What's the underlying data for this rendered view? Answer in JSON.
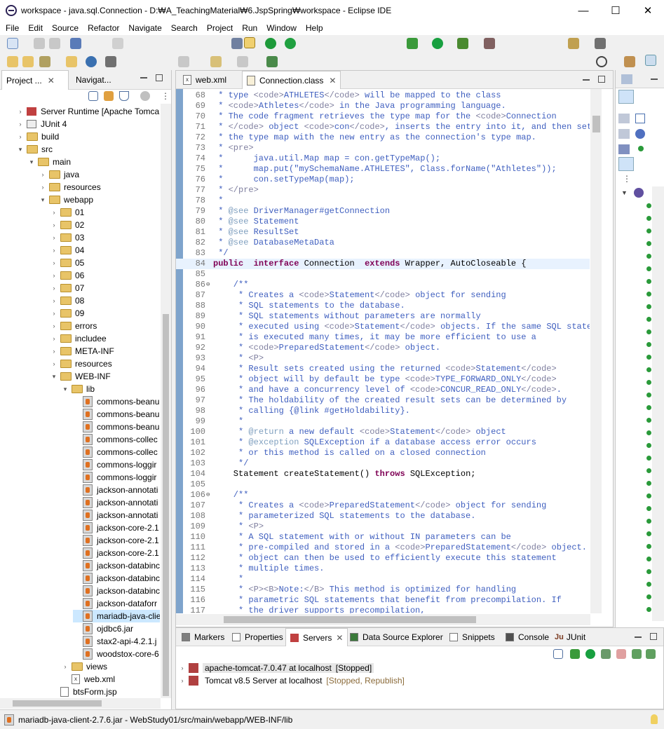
{
  "window": {
    "title": "workspace - java.sql.Connection - D:₩A_TeachingMaterial₩6.JspSpring₩workspace - Eclipse IDE",
    "minimize": "—",
    "maximize": "☐",
    "close": "✕"
  },
  "menu": [
    "File",
    "Edit",
    "Source",
    "Refactor",
    "Navigate",
    "Search",
    "Project",
    "Run",
    "Window",
    "Help"
  ],
  "left": {
    "tabs": [
      "Project ...",
      "Navigat..."
    ],
    "tree": [
      {
        "label": "Server Runtime [Apache Tomca",
        "icon": "server-runtime-icon",
        "depth": 1
      },
      {
        "label": "JUnit 4",
        "icon": "junit-library-icon",
        "depth": 1
      },
      {
        "label": "build",
        "icon": "folder-icon",
        "depth": 1
      },
      {
        "label": "src",
        "icon": "folder-icon",
        "depth": 1
      },
      {
        "label": "main",
        "icon": "folder-icon",
        "depth": 2
      },
      {
        "label": "java",
        "icon": "folder-icon",
        "depth": 3
      },
      {
        "label": "resources",
        "icon": "folder-icon",
        "depth": 3
      },
      {
        "label": "webapp",
        "icon": "folder-icon",
        "depth": 3
      },
      {
        "label": "01",
        "icon": "folder-icon",
        "depth": 4
      },
      {
        "label": "02",
        "icon": "folder-icon",
        "depth": 4
      },
      {
        "label": "03",
        "icon": "folder-icon",
        "depth": 4
      },
      {
        "label": "04",
        "icon": "folder-icon",
        "depth": 4
      },
      {
        "label": "05",
        "icon": "folder-icon",
        "depth": 4
      },
      {
        "label": "06",
        "icon": "folder-icon",
        "depth": 4
      },
      {
        "label": "07",
        "icon": "folder-icon",
        "depth": 4
      },
      {
        "label": "08",
        "icon": "folder-icon",
        "depth": 4
      },
      {
        "label": "09",
        "icon": "folder-icon",
        "depth": 4
      },
      {
        "label": "errors",
        "icon": "folder-icon",
        "depth": 4
      },
      {
        "label": "includee",
        "icon": "folder-icon",
        "depth": 4
      },
      {
        "label": "META-INF",
        "icon": "folder-icon",
        "depth": 4
      },
      {
        "label": "resources",
        "icon": "folder-icon",
        "depth": 4
      },
      {
        "label": "WEB-INF",
        "icon": "folder-icon",
        "depth": 4
      },
      {
        "label": "lib",
        "icon": "folder-icon",
        "depth": 5
      },
      {
        "label": "commons-beanu",
        "icon": "jar-icon",
        "depth": 6
      },
      {
        "label": "commons-beanu",
        "icon": "jar-icon",
        "depth": 6
      },
      {
        "label": "commons-beanu",
        "icon": "jar-icon",
        "depth": 6
      },
      {
        "label": "commons-collec",
        "icon": "jar-icon",
        "depth": 6
      },
      {
        "label": "commons-collec",
        "icon": "jar-icon",
        "depth": 6
      },
      {
        "label": "commons-loggir",
        "icon": "jar-icon",
        "depth": 6
      },
      {
        "label": "commons-loggir",
        "icon": "jar-icon",
        "depth": 6
      },
      {
        "label": "jackson-annotati",
        "icon": "jar-icon",
        "depth": 6
      },
      {
        "label": "jackson-annotati",
        "icon": "jar-icon",
        "depth": 6
      },
      {
        "label": "jackson-annotati",
        "icon": "jar-icon",
        "depth": 6
      },
      {
        "label": "jackson-core-2.1",
        "icon": "jar-icon",
        "depth": 6
      },
      {
        "label": "jackson-core-2.1",
        "icon": "jar-icon",
        "depth": 6
      },
      {
        "label": "jackson-core-2.1",
        "icon": "jar-icon",
        "depth": 6
      },
      {
        "label": "jackson-databinc",
        "icon": "jar-icon",
        "depth": 6
      },
      {
        "label": "jackson-databinc",
        "icon": "jar-icon",
        "depth": 6
      },
      {
        "label": "jackson-databinc",
        "icon": "jar-icon",
        "depth": 6
      },
      {
        "label": "jackson-dataforr",
        "icon": "jar-icon",
        "depth": 6
      },
      {
        "label": "mariadb-java-clie",
        "icon": "jar-icon",
        "depth": 6
      },
      {
        "label": "ojdbc6.jar",
        "icon": "jar-icon",
        "depth": 6
      },
      {
        "label": "stax2-api-4.2.1.j",
        "icon": "jar-icon",
        "depth": 6
      },
      {
        "label": "woodstox-core-6",
        "icon": "jar-icon",
        "depth": 6
      },
      {
        "label": "views",
        "icon": "folder-icon",
        "depth": 5
      },
      {
        "label": "web.xml",
        "icon": "xml-file-icon",
        "depth": 5
      },
      {
        "label": "btsForm.jsp",
        "icon": "jsp-file-icon",
        "depth": 4
      }
    ]
  },
  "editor": {
    "tabs": [
      "web.xml",
      "Connection.class"
    ],
    "lines": [
      {
        "n": "68",
        "t": [
          [
            "cm",
            " * type "
          ],
          [
            "tag",
            "<code>"
          ],
          [
            "cm",
            "ATHLETES"
          ],
          [
            "tag",
            "</code>"
          ],
          [
            "cm",
            " will be mapped to the class"
          ]
        ]
      },
      {
        "n": "69",
        "t": [
          [
            "cm",
            " * "
          ],
          [
            "tag",
            "<code>"
          ],
          [
            "cm",
            "Athletes"
          ],
          [
            "tag",
            "</code>"
          ],
          [
            "cm",
            " in the Java programming language."
          ]
        ]
      },
      {
        "n": "70",
        "t": [
          [
            "cm",
            " * The code fragment retrieves the type map for the "
          ],
          [
            "tag",
            "<code>"
          ],
          [
            "cm",
            "Connection"
          ]
        ]
      },
      {
        "n": "71",
        "t": [
          [
            "cm",
            " * "
          ],
          [
            "tag",
            "</code>"
          ],
          [
            "cm",
            " object "
          ],
          [
            "tag",
            "<code>"
          ],
          [
            "cm",
            "con"
          ],
          [
            "tag",
            "</code>"
          ],
          [
            "cm",
            ", inserts the entry into it, and then sets"
          ]
        ]
      },
      {
        "n": "72",
        "t": [
          [
            "cm",
            " * the type map with the new entry as the connection's type map."
          ]
        ]
      },
      {
        "n": "73",
        "t": [
          [
            "cm",
            " * "
          ],
          [
            "tag",
            "<pre>"
          ]
        ]
      },
      {
        "n": "74",
        "t": [
          [
            "cm",
            " *      java.util.Map map = con.getTypeMap();"
          ]
        ]
      },
      {
        "n": "75",
        "t": [
          [
            "cm",
            " *      map.put(\"mySchemaName.ATHLETES\", Class.forName(\"Athletes\"));"
          ]
        ]
      },
      {
        "n": "76",
        "t": [
          [
            "cm",
            " *      con.setTypeMap(map);"
          ]
        ]
      },
      {
        "n": "77",
        "t": [
          [
            "cm",
            " * "
          ],
          [
            "tag",
            "</pre>"
          ]
        ]
      },
      {
        "n": "78",
        "t": [
          [
            "cm",
            " *"
          ]
        ]
      },
      {
        "n": "79",
        "t": [
          [
            "cm",
            " * "
          ],
          [
            "ann",
            "@see"
          ],
          [
            "cm",
            " DriverManager#getConnection"
          ]
        ]
      },
      {
        "n": "80",
        "t": [
          [
            "cm",
            " * "
          ],
          [
            "ann",
            "@see"
          ],
          [
            "cm",
            " Statement"
          ]
        ]
      },
      {
        "n": "81",
        "t": [
          [
            "cm",
            " * "
          ],
          [
            "ann",
            "@see"
          ],
          [
            "cm",
            " ResultSet"
          ]
        ]
      },
      {
        "n": "82",
        "t": [
          [
            "cm",
            " * "
          ],
          [
            "ann",
            "@see"
          ],
          [
            "cm",
            " DatabaseMetaData"
          ]
        ]
      },
      {
        "n": "83",
        "t": [
          [
            "cm",
            " */"
          ]
        ]
      },
      {
        "n": "84",
        "t": [
          [
            "kw",
            "public"
          ],
          [
            "",
            "  "
          ],
          [
            "kw",
            "interface"
          ],
          [
            "",
            " Connection  "
          ],
          [
            "kw",
            "extends"
          ],
          [
            "",
            " Wrapper, AutoCloseable {"
          ]
        ]
      },
      {
        "n": "85",
        "t": []
      },
      {
        "n": "86",
        "t": [
          [
            "cm",
            "    /**"
          ]
        ]
      },
      {
        "n": "87",
        "t": [
          [
            "cm",
            "     * Creates a "
          ],
          [
            "tag",
            "<code>"
          ],
          [
            "cm",
            "Statement"
          ],
          [
            "tag",
            "</code>"
          ],
          [
            "cm",
            " object for sending"
          ]
        ]
      },
      {
        "n": "88",
        "t": [
          [
            "cm",
            "     * SQL statements to the database."
          ]
        ]
      },
      {
        "n": "89",
        "t": [
          [
            "cm",
            "     * SQL statements without parameters are normally"
          ]
        ]
      },
      {
        "n": "90",
        "t": [
          [
            "cm",
            "     * executed using "
          ],
          [
            "tag",
            "<code>"
          ],
          [
            "cm",
            "Statement"
          ],
          [
            "tag",
            "</code>"
          ],
          [
            "cm",
            " objects. If the same SQL stateme"
          ]
        ]
      },
      {
        "n": "91",
        "t": [
          [
            "cm",
            "     * is executed many times, it may be more efficient to use a"
          ]
        ]
      },
      {
        "n": "92",
        "t": [
          [
            "cm",
            "     * "
          ],
          [
            "tag",
            "<code>"
          ],
          [
            "cm",
            "PreparedStatement"
          ],
          [
            "tag",
            "</code>"
          ],
          [
            "cm",
            " object."
          ]
        ]
      },
      {
        "n": "93",
        "t": [
          [
            "cm",
            "     * "
          ],
          [
            "tag",
            "<P>"
          ]
        ]
      },
      {
        "n": "94",
        "t": [
          [
            "cm",
            "     * Result sets created using the returned "
          ],
          [
            "tag",
            "<code>"
          ],
          [
            "cm",
            "Statement"
          ],
          [
            "tag",
            "</code>"
          ]
        ]
      },
      {
        "n": "95",
        "t": [
          [
            "cm",
            "     * object will by default be type "
          ],
          [
            "tag",
            "<code>"
          ],
          [
            "cm",
            "TYPE_FORWARD_ONLY"
          ],
          [
            "tag",
            "</code>"
          ]
        ]
      },
      {
        "n": "96",
        "t": [
          [
            "cm",
            "     * and have a concurrency level of "
          ],
          [
            "tag",
            "<code>"
          ],
          [
            "cm",
            "CONCUR_READ_ONLY"
          ],
          [
            "tag",
            "</code>"
          ],
          [
            "cm",
            "."
          ]
        ]
      },
      {
        "n": "97",
        "t": [
          [
            "cm",
            "     * The holdability of the created result sets can be determined by"
          ]
        ]
      },
      {
        "n": "98",
        "t": [
          [
            "cm",
            "     * calling {@link #getHoldability}."
          ]
        ]
      },
      {
        "n": "99",
        "t": [
          [
            "cm",
            "     *"
          ]
        ]
      },
      {
        "n": "100",
        "t": [
          [
            "cm",
            "     * "
          ],
          [
            "ann",
            "@return"
          ],
          [
            "cm",
            " a new default "
          ],
          [
            "tag",
            "<code>"
          ],
          [
            "cm",
            "Statement"
          ],
          [
            "tag",
            "</code>"
          ],
          [
            "cm",
            " object"
          ]
        ]
      },
      {
        "n": "101",
        "t": [
          [
            "cm",
            "     * "
          ],
          [
            "ann",
            "@exception"
          ],
          [
            "cm",
            " SQLException if a database access error occurs"
          ]
        ]
      },
      {
        "n": "102",
        "t": [
          [
            "cm",
            "     * or this method is called on a closed connection"
          ]
        ]
      },
      {
        "n": "103",
        "t": [
          [
            "cm",
            "     */"
          ]
        ]
      },
      {
        "n": "104",
        "t": [
          [
            "",
            "    Statement createStatement() "
          ],
          [
            "kw",
            "throws"
          ],
          [
            "",
            " SQLException;"
          ]
        ]
      },
      {
        "n": "105",
        "t": []
      },
      {
        "n": "106",
        "t": [
          [
            "cm",
            "    /**"
          ]
        ]
      },
      {
        "n": "107",
        "t": [
          [
            "cm",
            "     * Creates a "
          ],
          [
            "tag",
            "<code>"
          ],
          [
            "cm",
            "PreparedStatement"
          ],
          [
            "tag",
            "</code>"
          ],
          [
            "cm",
            " object for sending"
          ]
        ]
      },
      {
        "n": "108",
        "t": [
          [
            "cm",
            "     * parameterized SQL statements to the database."
          ]
        ]
      },
      {
        "n": "109",
        "t": [
          [
            "cm",
            "     * "
          ],
          [
            "tag",
            "<P>"
          ]
        ]
      },
      {
        "n": "110",
        "t": [
          [
            "cm",
            "     * A SQL statement with or without IN parameters can be"
          ]
        ]
      },
      {
        "n": "111",
        "t": [
          [
            "cm",
            "     * pre-compiled and stored in a "
          ],
          [
            "tag",
            "<code>"
          ],
          [
            "cm",
            "PreparedStatement"
          ],
          [
            "tag",
            "</code>"
          ],
          [
            "cm",
            " object. Th"
          ]
        ]
      },
      {
        "n": "112",
        "t": [
          [
            "cm",
            "     * object can then be used to efficiently execute this statement"
          ]
        ]
      },
      {
        "n": "113",
        "t": [
          [
            "cm",
            "     * multiple times."
          ]
        ]
      },
      {
        "n": "114",
        "t": [
          [
            "cm",
            "     *"
          ]
        ]
      },
      {
        "n": "115",
        "t": [
          [
            "cm",
            "     * "
          ],
          [
            "tag",
            "<P><B>"
          ],
          [
            "cm",
            "Note:"
          ],
          [
            "tag",
            "</B>"
          ],
          [
            "cm",
            " This method is optimized for handling"
          ]
        ]
      },
      {
        "n": "116",
        "t": [
          [
            "cm",
            "     * parametric SQL statements that benefit from precompilation. If"
          ]
        ]
      },
      {
        "n": "117",
        "t": [
          [
            "cm",
            "     * the driver supports precompilation,"
          ]
        ]
      }
    ]
  },
  "bottom": {
    "tabs": [
      "Markers",
      "Properties",
      "Servers",
      "Data Source Explorer",
      "Snippets",
      "Console",
      "JUnit"
    ],
    "servers": [
      {
        "name": "apache-tomcat-7.0.47 at localhost",
        "state": "[Stopped]"
      },
      {
        "name": "Tomcat v8.5 Server at localhost",
        "state": "[Stopped, Republish]"
      }
    ]
  },
  "status": {
    "text": "mariadb-java-client-2.7.6.jar - WebStudy01/src/main/webapp/WEB-INF/lib"
  },
  "colors": {
    "comment": "#3f5fbf",
    "keyword": "#7f0055",
    "tag": "#7f7f9f",
    "annotation": "#7f9fbf",
    "selection": "#cce8ff"
  }
}
